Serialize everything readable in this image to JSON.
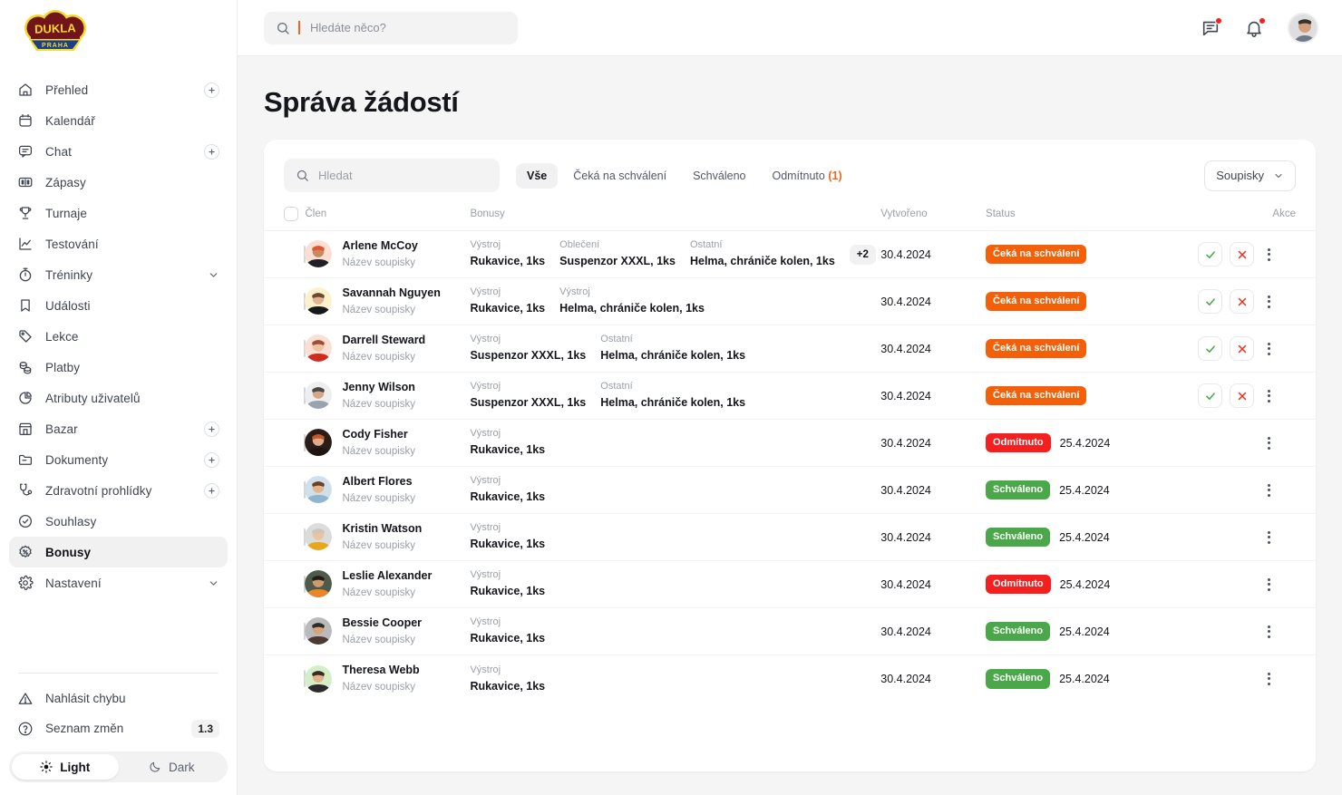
{
  "sidebar": {
    "logo": {
      "top_text": "DUKLA",
      "bottom_text": "PRAHA",
      "name": "dukla-praha-logo"
    },
    "items": [
      {
        "label": "Přehled",
        "icon": "home-icon",
        "plus": true,
        "chevron": false,
        "active": false
      },
      {
        "label": "Kalendář",
        "icon": "calendar-icon",
        "plus": false,
        "chevron": false,
        "active": false
      },
      {
        "label": "Chat",
        "icon": "chat-icon",
        "plus": true,
        "chevron": false,
        "active": false
      },
      {
        "label": "Zápasy",
        "icon": "scoreboard-icon",
        "plus": false,
        "chevron": false,
        "active": false
      },
      {
        "label": "Turnaje",
        "icon": "trophy-icon",
        "plus": false,
        "chevron": false,
        "active": false
      },
      {
        "label": "Testování",
        "icon": "chart-line-icon",
        "plus": false,
        "chevron": false,
        "active": false
      },
      {
        "label": "Tréninky",
        "icon": "stopwatch-icon",
        "plus": false,
        "chevron": true,
        "active": false
      },
      {
        "label": "Události",
        "icon": "bookmark-icon",
        "plus": false,
        "chevron": false,
        "active": false
      },
      {
        "label": "Lekce",
        "icon": "tag-icon",
        "plus": false,
        "chevron": false,
        "active": false
      },
      {
        "label": "Platby",
        "icon": "coins-icon",
        "plus": false,
        "chevron": false,
        "active": false
      },
      {
        "label": "Atributy uživatelů",
        "icon": "pie-chart-icon",
        "plus": false,
        "chevron": false,
        "active": false
      },
      {
        "label": "Bazar",
        "icon": "store-icon",
        "plus": true,
        "chevron": false,
        "active": false
      },
      {
        "label": "Dokumenty",
        "icon": "folder-icon",
        "plus": true,
        "chevron": false,
        "active": false
      },
      {
        "label": "Zdravotní prohlídky",
        "icon": "stethoscope-icon",
        "plus": true,
        "chevron": false,
        "active": false
      },
      {
        "label": "Souhlasy",
        "icon": "check-circle-icon",
        "plus": false,
        "chevron": false,
        "active": false
      },
      {
        "label": "Bonusy",
        "icon": "badge-percent-icon",
        "plus": false,
        "chevron": false,
        "active": true
      },
      {
        "label": "Nastavení",
        "icon": "gear-icon",
        "plus": false,
        "chevron": true,
        "active": false
      }
    ],
    "bottom": {
      "report_bug": "Nahlásit chybu",
      "changelog": "Seznam změn",
      "version": "1.3",
      "theme_light": "Light",
      "theme_dark": "Dark",
      "theme_selected": "Light"
    }
  },
  "topbar": {
    "search_placeholder": "Hledáte něco?",
    "search_value": "",
    "messages_has_unread": true,
    "notifications_has_unread": true
  },
  "page": {
    "title": "Správa žádostí"
  },
  "toolbar": {
    "search_placeholder": "Hledat",
    "search_value": "",
    "tabs": [
      {
        "label": "Vše",
        "count": "",
        "active": true
      },
      {
        "label": "Čeká na schválení",
        "count": "",
        "active": false
      },
      {
        "label": "Schváleno",
        "count": "",
        "active": false
      },
      {
        "label": "Odmítnuto",
        "count": "(1)",
        "active": false
      }
    ],
    "dropdown_label": "Soupisky"
  },
  "table": {
    "headers": {
      "member": "Člen",
      "bonuses": "Bonusy",
      "created": "Vytvořeno",
      "status": "Status",
      "actions": "Akce"
    },
    "rows": [
      {
        "name": "Arlene McCoy",
        "roster": "Název soupisky",
        "avatar_bg": "#fbdfd2",
        "avatar_hair": "#e2552f",
        "avatar_skin": "#c98a62",
        "avatar_shirt": "#1f2023",
        "bonuses": [
          {
            "category": "Výstroj",
            "value": "Rukavice, 1ks"
          },
          {
            "category": "Oblečení",
            "value": "Suspenzor XXXL, 1ks"
          },
          {
            "category": "Ostatní",
            "value": "Helma, chrániče kolen, 1ks"
          }
        ],
        "more": "+2",
        "created": "30.4.2024",
        "status": "Čeká na schválení",
        "status_kind": "pending",
        "resolved": "",
        "show_approve_reject": true
      },
      {
        "name": "Savannah Nguyen",
        "roster": "Název soupisky",
        "avatar_bg": "#fdf0cd",
        "avatar_hair": "#6b4a2f",
        "avatar_skin": "#e2b48f",
        "avatar_shirt": "#17181b",
        "bonuses": [
          {
            "category": "Výstroj",
            "value": "Rukavice, 1ks"
          },
          {
            "category": "Výstroj",
            "value": "Helma, chrániče kolen, 1ks"
          }
        ],
        "more": "",
        "created": "30.4.2024",
        "status": "Čeká na schválení",
        "status_kind": "pending",
        "resolved": "",
        "show_approve_reject": true
      },
      {
        "name": "Darrell Steward",
        "roster": "Název soupisky",
        "avatar_bg": "#fbdfd2",
        "avatar_hair": "#9c4f33",
        "avatar_skin": "#eec2a3",
        "avatar_shirt": "#cf2b20",
        "bonuses": [
          {
            "category": "Výstroj",
            "value": "Suspenzor XXXL, 1ks"
          },
          {
            "category": "Ostatní",
            "value": "Helma, chrániče kolen, 1ks"
          }
        ],
        "more": "",
        "created": "30.4.2024",
        "status": "Čeká na schválení",
        "status_kind": "pending",
        "resolved": "",
        "show_approve_reject": true
      },
      {
        "name": "Jenny Wilson",
        "roster": "Název soupisky",
        "avatar_bg": "#eceef0",
        "avatar_hair": "#4a4845",
        "avatar_skin": "#d5a687",
        "avatar_shirt": "#9aa3ad",
        "bonuses": [
          {
            "category": "Výstroj",
            "value": "Suspenzor XXXL, 1ks"
          },
          {
            "category": "Ostatní",
            "value": "Helma, chrániče kolen, 1ks"
          }
        ],
        "more": "",
        "created": "30.4.2024",
        "status": "Čeká na schválení",
        "status_kind": "pending",
        "resolved": "",
        "show_approve_reject": true
      },
      {
        "name": "Cody Fisher",
        "roster": "Název soupisky",
        "avatar_bg": "#2a1d17",
        "avatar_hair": "#c4582c",
        "avatar_skin": "#e0ab86",
        "avatar_shirt": "#1d1512",
        "bonuses": [
          {
            "category": "Výstroj",
            "value": "Rukavice, 1ks"
          }
        ],
        "more": "",
        "created": "30.4.2024",
        "status": "Odmítnuto",
        "status_kind": "rejected",
        "resolved": "25.4.2024",
        "show_approve_reject": false
      },
      {
        "name": "Albert Flores",
        "roster": "Název soupisky",
        "avatar_bg": "#cfe0ea",
        "avatar_hair": "#6a4326",
        "avatar_skin": "#e6b48c",
        "avatar_shirt": "#8fb5cf",
        "bonuses": [
          {
            "category": "Výstroj",
            "value": "Rukavice, 1ks"
          }
        ],
        "more": "",
        "created": "30.4.2024",
        "status": "Schváleno",
        "status_kind": "approved",
        "resolved": "25.4.2024",
        "show_approve_reject": false
      },
      {
        "name": "Kristin Watson",
        "roster": "Název soupisky",
        "avatar_bg": "#dcdcda",
        "avatar_hair": "#c9c6be",
        "avatar_skin": "#ecc3a1",
        "avatar_shirt": "#e8a81c",
        "bonuses": [
          {
            "category": "Výstroj",
            "value": "Rukavice, 1ks"
          }
        ],
        "more": "",
        "created": "30.4.2024",
        "status": "Schváleno",
        "status_kind": "approved",
        "resolved": "25.4.2024",
        "show_approve_reject": false
      },
      {
        "name": "Leslie Alexander",
        "roster": "Název soupisky",
        "avatar_bg": "#4e5b4a",
        "avatar_hair": "#231d19",
        "avatar_skin": "#cf9a6e",
        "avatar_shirt": "#e8872a",
        "bonuses": [
          {
            "category": "Výstroj",
            "value": "Rukavice, 1ks"
          }
        ],
        "more": "",
        "created": "30.4.2024",
        "status": "Odmítnuto",
        "status_kind": "rejected",
        "resolved": "25.4.2024",
        "show_approve_reject": false
      },
      {
        "name": "Bessie Cooper",
        "roster": "Název soupisky",
        "avatar_bg": "#b9babc",
        "avatar_hair": "#2e2b28",
        "avatar_skin": "#d9a379",
        "avatar_shirt": "#4c3a30",
        "bonuses": [
          {
            "category": "Výstroj",
            "value": "Rukavice, 1ks"
          }
        ],
        "more": "",
        "created": "30.4.2024",
        "status": "Schváleno",
        "status_kind": "approved",
        "resolved": "25.4.2024",
        "show_approve_reject": false
      },
      {
        "name": "Theresa Webb",
        "roster": "Název soupisky",
        "avatar_bg": "#d4efc8",
        "avatar_hair": "#3a2a20",
        "avatar_skin": "#e3b28d",
        "avatar_shirt": "#2b2b2b",
        "bonuses": [
          {
            "category": "Výstroj",
            "value": "Rukavice, 1ks"
          }
        ],
        "more": "",
        "created": "30.4.2024",
        "status": "Schváleno",
        "status_kind": "approved",
        "resolved": "25.4.2024",
        "show_approve_reject": false
      }
    ]
  },
  "colors": {
    "accent_orange": "#f26522",
    "pending": "#f4600a",
    "rejected": "#f41f1f",
    "approved": "#4aa84a",
    "approve_check": "#4aa84a",
    "reject_x": "#e8311f"
  }
}
